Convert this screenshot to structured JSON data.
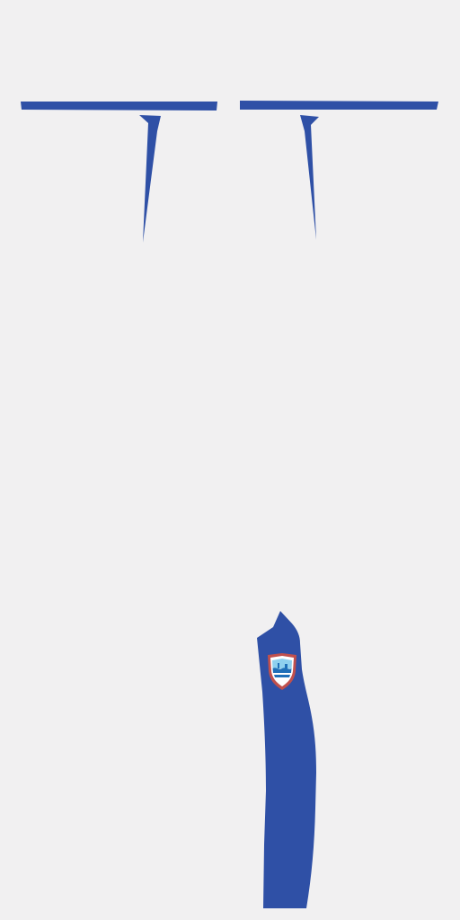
{
  "colors": {
    "background": "#f1f0f1",
    "trim": "#2f50a6",
    "crest_border": "#c0504d",
    "crest_fill": "#ffffff",
    "crest_sky": "#8fd0ee",
    "crest_water": "#1f6fb8"
  },
  "pieces": [
    {
      "name": "left-sleeve-cuff-stripe"
    },
    {
      "name": "right-sleeve-cuff-stripe"
    },
    {
      "name": "left-collar-point"
    },
    {
      "name": "right-collar-point"
    },
    {
      "name": "side-panel-with-crest"
    }
  ],
  "crest": {
    "icon": "shield-crest-icon"
  }
}
